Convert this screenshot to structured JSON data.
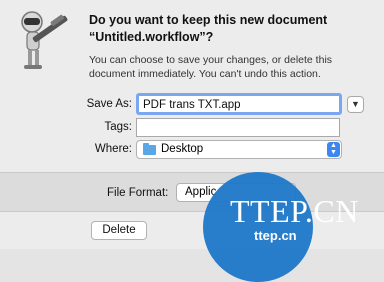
{
  "dialog": {
    "title": "Do you want to keep this new document “Untitled.workflow”?",
    "message": "You can choose to save your changes, or delete this document immediately. You can't undo this action."
  },
  "form": {
    "save_as_label": "Save As:",
    "save_as_value": "PDF trans  TXT.app",
    "tags_label": "Tags:",
    "tags_value": "",
    "where_label": "Where:",
    "where_value": "Desktop",
    "file_format_label": "File Format:",
    "file_format_value": "Applic"
  },
  "buttons": {
    "delete_label": "Delete"
  },
  "watermark": {
    "main": "TTEP.CN",
    "sub": "ttep.cn",
    "color": "#1f79c9"
  },
  "icons": {
    "app": "automator-robot-icon",
    "expand": "chevron-down-icon",
    "folder": "folder-icon",
    "stepper": "stepper-icon"
  }
}
